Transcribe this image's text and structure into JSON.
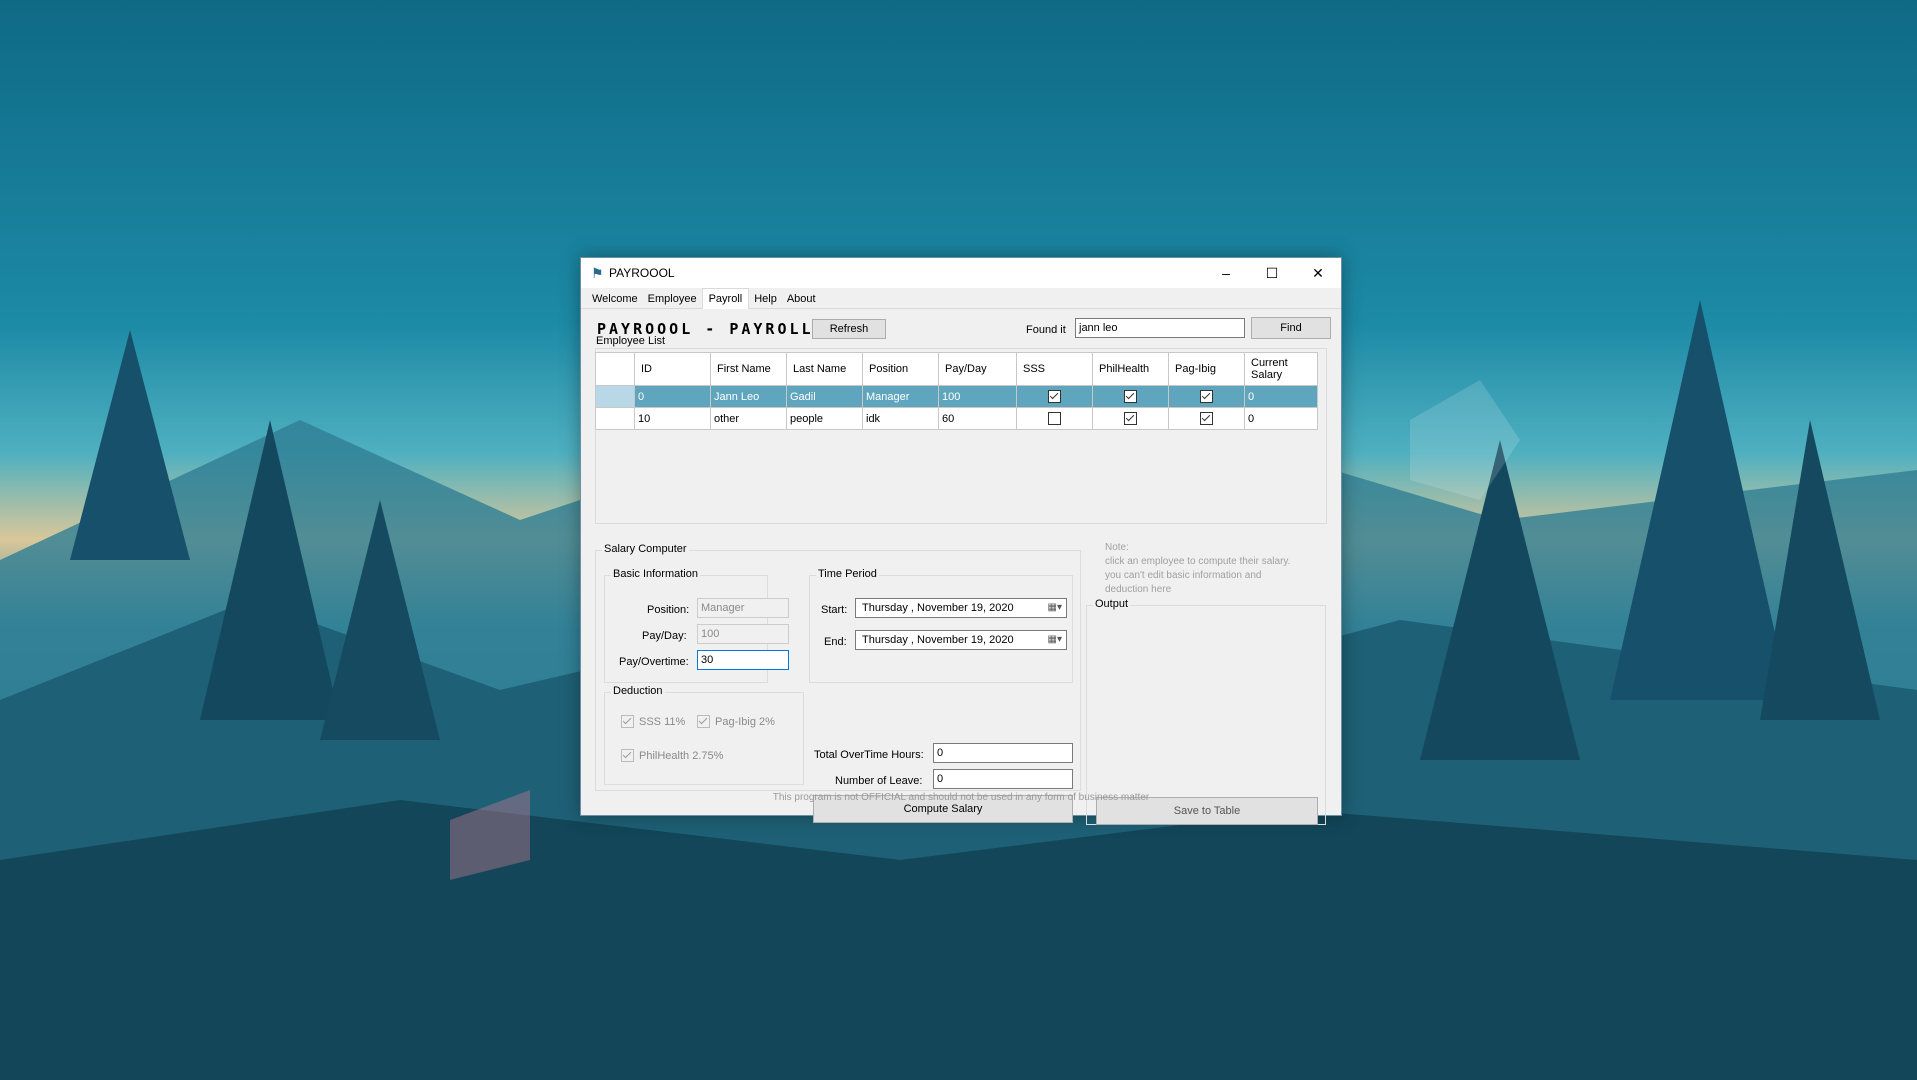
{
  "window": {
    "title": "PAYROOOL",
    "controls": [
      "–",
      "☐",
      "✕"
    ]
  },
  "tabs": [
    {
      "label": "Welcome",
      "active": false
    },
    {
      "label": "Employee",
      "active": false
    },
    {
      "label": "Payroll",
      "active": true
    },
    {
      "label": "Help",
      "active": false
    },
    {
      "label": "About",
      "active": false
    }
  ],
  "header": {
    "title": "PAYROOOL - PAYROLL",
    "refresh_label": "Refresh",
    "found_label": "Found it",
    "search_value": "jann leo",
    "find_label": "Find"
  },
  "employee_list": {
    "label": "Employee List",
    "columns": [
      "ID",
      "First Name",
      "Last Name",
      "Position",
      "Pay/Day",
      "SSS",
      "PhilHealth",
      "Pag-Ibig",
      "Current Salary"
    ],
    "rows": [
      {
        "id": "0",
        "first": "Jann Leo",
        "last": "Gadil",
        "position": "Manager",
        "pay_day": "100",
        "sss": true,
        "philhealth": true,
        "pagibig": true,
        "salary": "0",
        "selected": true
      },
      {
        "id": "10",
        "first": "other",
        "last": "people",
        "position": "idk",
        "pay_day": "60",
        "sss": false,
        "philhealth": true,
        "pagibig": true,
        "salary": "0",
        "selected": false
      }
    ]
  },
  "salary_computer": {
    "label": "Salary Computer",
    "basic_info": {
      "label": "Basic Information",
      "position_label": "Position:",
      "position_value": "Manager",
      "payday_label": "Pay/Day:",
      "payday_value": "100",
      "overtime_label": "Pay/Overtime:",
      "overtime_value": "30"
    },
    "time_period": {
      "label": "Time Period",
      "start_label": "Start:",
      "start_value": "Thursday   ,  November 19, 2020",
      "end_label": "End:",
      "end_value": "Thursday   ,  November 19, 2020"
    },
    "deduction": {
      "label": "Deduction",
      "sss_label": "SSS 11%",
      "pagibig_label": "Pag-Ibig 2%",
      "philhealth_label": "PhilHealth 2.75%"
    },
    "overtime_hours_label": "Total OverTime Hours:",
    "overtime_hours_value": "0",
    "leave_label": "Number of Leave:",
    "leave_value": "0",
    "compute_label": "Compute Salary"
  },
  "note": {
    "title": "Note:",
    "line1": "click an employee to compute their salary.",
    "line2": "you can't edit basic information and",
    "line3": "deduction here"
  },
  "output": {
    "label": "Output",
    "save_label": "Save to Table"
  },
  "footer": "This program is not OFFICIAL and should not be used in any form of business matter"
}
